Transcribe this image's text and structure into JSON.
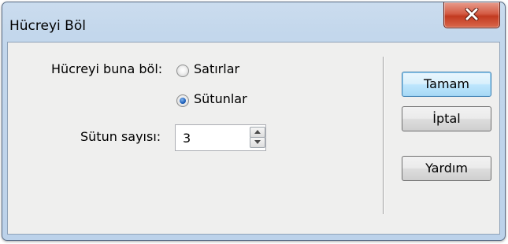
{
  "window": {
    "title": "Hücreyi Böl"
  },
  "form": {
    "split_label": "Hücreyi buna böl:",
    "options": [
      {
        "label": "Satırlar",
        "checked": false
      },
      {
        "label": "Sütunlar",
        "checked": true
      }
    ],
    "count_label": "Sütun sayısı:",
    "count_value": "3"
  },
  "buttons": {
    "ok": "Tamam",
    "cancel": "İptal",
    "help": "Yardım"
  },
  "icons": {
    "close": "close-icon",
    "spin_up": "spin-up-arrow-icon",
    "spin_down": "spin-down-arrow-icon"
  }
}
